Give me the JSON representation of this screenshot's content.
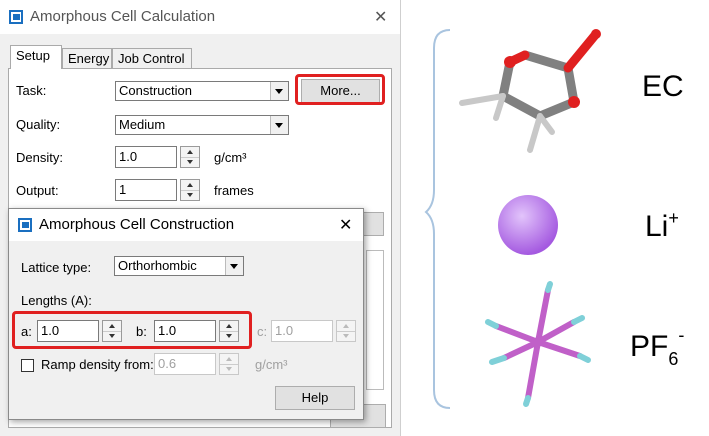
{
  "main": {
    "title": "Amorphous Cell Calculation",
    "tabs": [
      "Setup",
      "Energy",
      "Job Control"
    ],
    "task_label": "Task:",
    "task_value": "Construction",
    "more_button": "More...",
    "quality_label": "Quality:",
    "quality_value": "Medium",
    "density_label": "Density:",
    "density_value": "1.0",
    "density_unit": "g/cm³",
    "output_label": "Output:",
    "output_value": "1",
    "output_unit": "frames"
  },
  "child": {
    "title": "Amorphous Cell Construction",
    "lattice_label": "Lattice type:",
    "lattice_value": "Orthorhombic",
    "lengths_label": "Lengths (A):",
    "a_label": "a:",
    "a_value": "1.0",
    "b_label": "b:",
    "b_value": "1.0",
    "c_label": "c:",
    "c_value": "1.0",
    "ramp_label": "Ramp density from:",
    "ramp_value": "0.6",
    "ramp_unit": "g/cm³",
    "help_button": "Help"
  },
  "molecules": {
    "ec_label": "EC",
    "li_base": "Li",
    "li_sup": "+",
    "pf_base": "PF",
    "pf_sub": "6",
    "pf_sup": "-"
  },
  "colors": {
    "highlight": "#e02020",
    "oxygen": "#e02020",
    "carbon": "#707070",
    "lithium": "#b870e8",
    "fluorine": "#7fd0d8",
    "phosphorus": "#c060c8",
    "bracket": "#a9c4df"
  }
}
